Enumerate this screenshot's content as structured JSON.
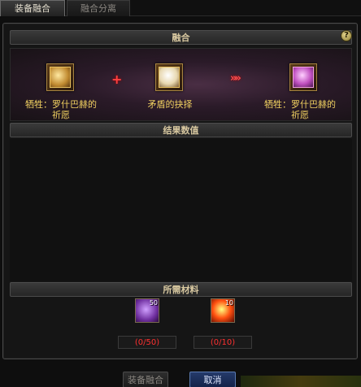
{
  "tabs": {
    "active": "装备融合",
    "inactive": "融合分离"
  },
  "fusion": {
    "header": "融合",
    "help": "?",
    "left_item": "牺牲：罗什巴赫的\n祈愿",
    "middle_item": "矛盾的抉择",
    "right_item": "牺牲：罗什巴赫的\n祈愿",
    "plus": "+",
    "arrow": "»»"
  },
  "result": {
    "header": "结果数值"
  },
  "materials": {
    "header": "所需材料",
    "items": [
      {
        "count": "50",
        "qty": "(0/50)"
      },
      {
        "count": "10",
        "qty": "(0/10)"
      }
    ]
  },
  "buttons": {
    "fuse": "装备融合",
    "cancel": "取消"
  }
}
